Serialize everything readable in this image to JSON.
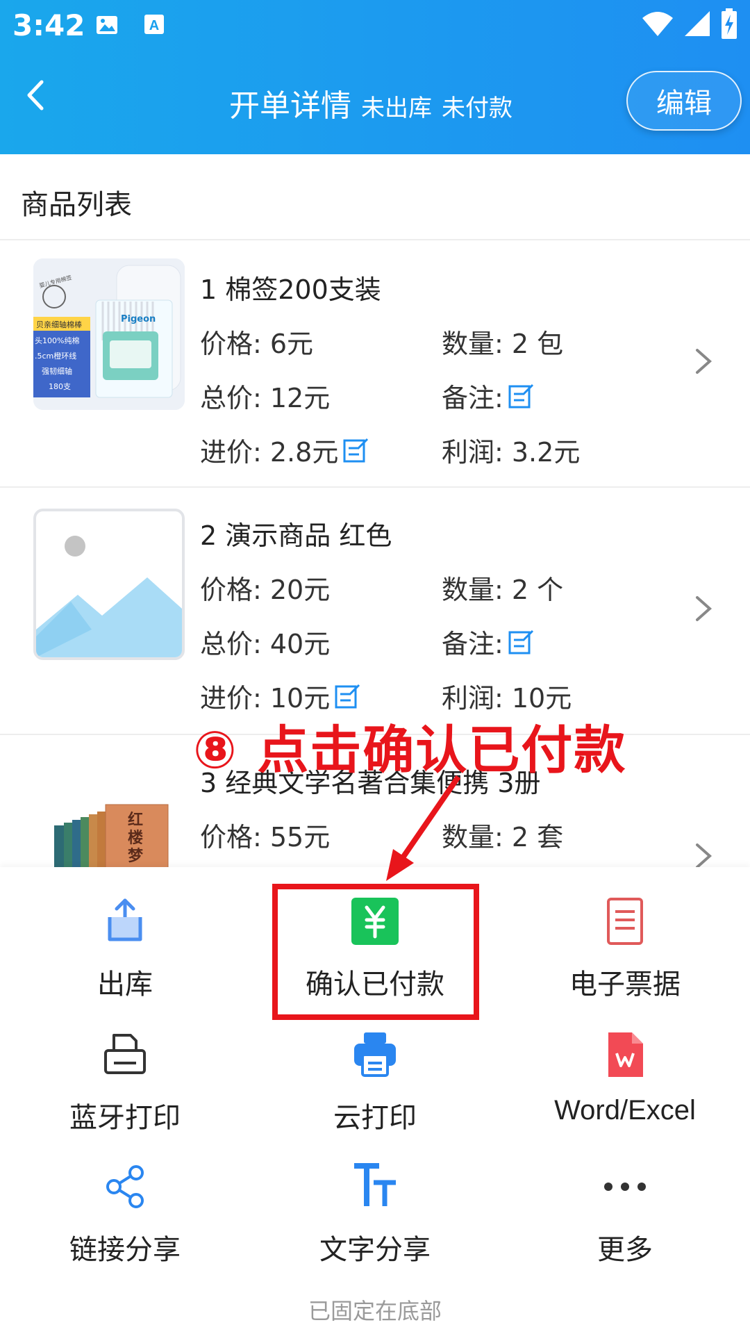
{
  "status_bar": {
    "time": "3:42"
  },
  "header": {
    "title": "开单详情",
    "status_outbound": "未出库",
    "status_payment": "未付款",
    "edit_label": "编辑"
  },
  "section_title": "商品列表",
  "items": [
    {
      "name": "1 棉签200支装",
      "price": "价格: 6元",
      "quantity": "数量: 2 包",
      "total": "总价: 12元",
      "note_label": "备注:",
      "cost": "进价: 2.8元",
      "profit": "利润: 3.2元",
      "thumb_text": [
        "婴儿专用棉签",
        "贝亲细轴棉棒",
        "头100%纯棉",
        ".5cm橙环线",
        "强韧细轴",
        "180支"
      ],
      "thumb_brand": "Pigeon"
    },
    {
      "name": "2 演示商品 红色",
      "price": "价格: 20元",
      "quantity": "数量: 2 个",
      "total": "总价: 40元",
      "note_label": "备注:",
      "cost": "进价: 10元",
      "profit": "利润: 10元"
    },
    {
      "name": "3 经典文学名著合集便携 3册",
      "price": "价格: 55元",
      "quantity": "数量: 2 套",
      "thumb_title": "红楼梦"
    }
  ],
  "annotation": {
    "text": "⑧ 点击确认已付款",
    "color": "#e8151b"
  },
  "actions": [
    {
      "label": "出库",
      "icon": "upload-icon"
    },
    {
      "label": "确认已付款",
      "icon": "yuan-icon"
    },
    {
      "label": "电子票据",
      "icon": "receipt-icon"
    },
    {
      "label": "蓝牙打印",
      "icon": "printer-outline-icon"
    },
    {
      "label": "云打印",
      "icon": "cloud-printer-icon"
    },
    {
      "label": "Word/Excel",
      "icon": "word-file-icon"
    },
    {
      "label": "链接分享",
      "icon": "share-icon"
    },
    {
      "label": "文字分享",
      "icon": "text-icon"
    },
    {
      "label": "更多",
      "icon": "more-icon"
    }
  ],
  "footer_note": "已固定在底部",
  "colors": {
    "header_start": "#1aa7ec",
    "header_end": "#1e8ff2",
    "accent_blue": "#1e8ff2",
    "pay_green": "#19c35a",
    "receipt_red": "#e05a5a",
    "word_red": "#f24a55"
  }
}
